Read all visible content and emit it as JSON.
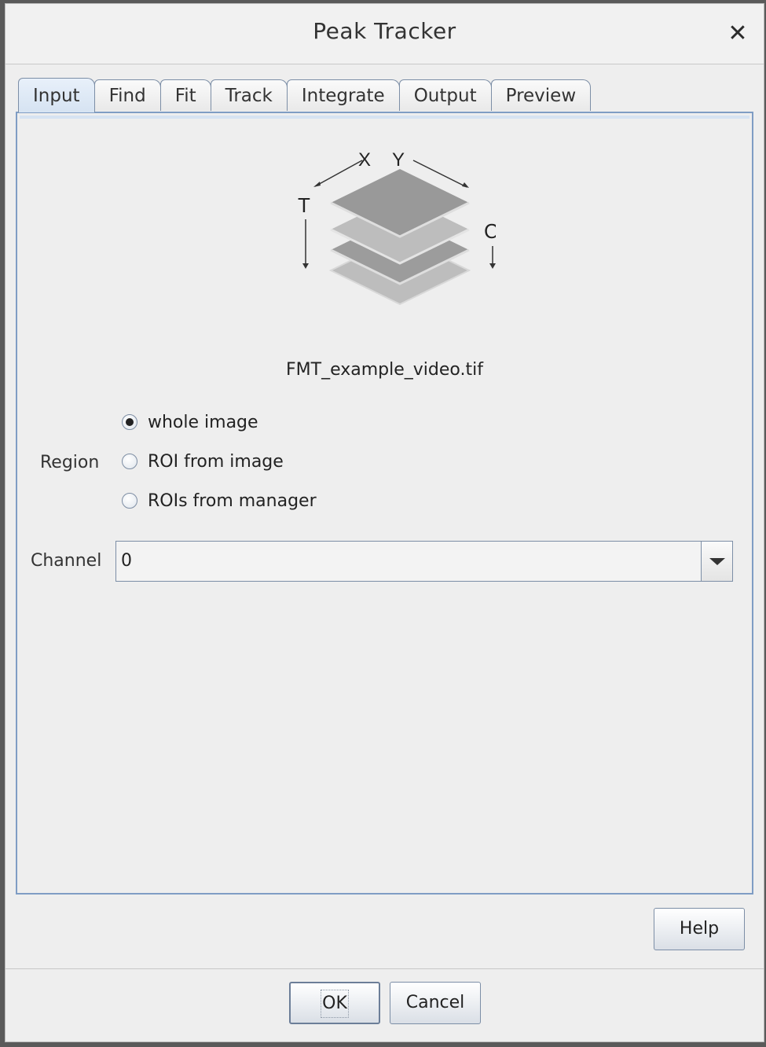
{
  "window": {
    "title": "Peak Tracker",
    "close_glyph": "✕"
  },
  "tabs": [
    {
      "label": "Input",
      "active": true
    },
    {
      "label": "Find",
      "active": false
    },
    {
      "label": "Fit",
      "active": false
    },
    {
      "label": "Track",
      "active": false
    },
    {
      "label": "Integrate",
      "active": false
    },
    {
      "label": "Output",
      "active": false
    },
    {
      "label": "Preview",
      "active": false
    }
  ],
  "input": {
    "stack_icon": {
      "name": "image-stack-icon",
      "axis_labels": {
        "x": "X",
        "y": "Y",
        "t": "T",
        "c": "C"
      }
    },
    "filename": "FMT_example_video.tif",
    "region": {
      "label": "Region",
      "options": [
        {
          "label": "whole image",
          "selected": true
        },
        {
          "label": "ROI from image",
          "selected": false
        },
        {
          "label": "ROIs from manager",
          "selected": false
        }
      ]
    },
    "channel": {
      "label": "Channel",
      "value": "0"
    }
  },
  "buttons": {
    "help": "Help",
    "ok": "OK",
    "cancel": "Cancel"
  },
  "colors": {
    "tab_border": "#7c8ea6",
    "active_tab": "#d6e3f2",
    "panel_border": "#7f9dc4",
    "background": "#eeeeee"
  }
}
